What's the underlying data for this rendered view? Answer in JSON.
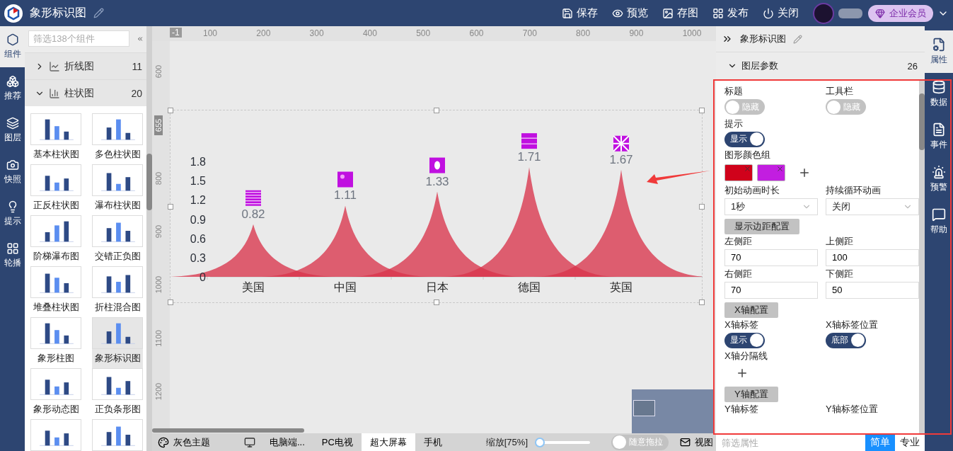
{
  "header": {
    "title": "象形标识图",
    "actions": [
      {
        "kind": "save",
        "label": "保存"
      },
      {
        "kind": "preview",
        "label": "预览"
      },
      {
        "kind": "image",
        "label": "存图"
      },
      {
        "kind": "publish",
        "label": "发布"
      },
      {
        "kind": "close",
        "label": "关闭"
      }
    ],
    "member": "企业会员"
  },
  "left_rail": [
    {
      "label": "组件",
      "selected": true
    },
    {
      "label": "推荐",
      "selected": false
    },
    {
      "label": "图层",
      "selected": false
    },
    {
      "label": "快照",
      "selected": false
    },
    {
      "label": "提示",
      "selected": false
    },
    {
      "label": "轮播",
      "selected": false
    }
  ],
  "components": {
    "search": {
      "placeholder": "筛选138个组件"
    },
    "categories": [
      {
        "label": "折线图",
        "count": "11",
        "expanded": false
      },
      {
        "label": "柱状图",
        "count": "20",
        "expanded": true
      }
    ],
    "items": [
      {
        "label": "基本柱状图",
        "selected": false
      },
      {
        "label": "多色柱状图",
        "selected": false
      },
      {
        "label": "正反柱状图",
        "selected": false
      },
      {
        "label": "瀑布柱状图",
        "selected": false
      },
      {
        "label": "阶梯瀑布图",
        "selected": false
      },
      {
        "label": "交错正负图",
        "selected": false
      },
      {
        "label": "堆叠柱状图",
        "selected": false
      },
      {
        "label": "折柱混合图",
        "selected": false
      },
      {
        "label": "象形柱图",
        "selected": false
      },
      {
        "label": "象形标识图",
        "selected": true
      },
      {
        "label": "象形动态图",
        "selected": false
      },
      {
        "label": "正负条形图",
        "selected": false
      }
    ]
  },
  "canvas": {
    "ruler_top": {
      "marker": "-1",
      "labels": [
        "100",
        "200",
        "300",
        "400",
        "500",
        "600",
        "700",
        "800",
        "900",
        "1000"
      ]
    },
    "ruler_left": {
      "marker": "655",
      "labels": [
        "600",
        "800",
        "900",
        "1000",
        "1100",
        "1200"
      ]
    },
    "chart": {
      "chart_data": {
        "type": "area",
        "categories": [
          "美国",
          "中国",
          "日本",
          "德国",
          "英国"
        ],
        "values": [
          0.82,
          1.11,
          1.33,
          1.71,
          1.67
        ],
        "ylim": [
          0,
          1.8
        ],
        "yticks": [
          0,
          0.3,
          0.6,
          0.9,
          1.2,
          1.5,
          1.8
        ],
        "data_labels": true
      }
    }
  },
  "properties": {
    "title": "象形标识图",
    "section": {
      "label": "图层参数",
      "count": "26",
      "expanded": true
    },
    "rows": [
      [
        {
          "kind": "toggle",
          "label": "标题",
          "on": false,
          "text": "隐藏"
        },
        {
          "kind": "toggle",
          "label": "工具栏",
          "on": false,
          "text": "隐藏"
        }
      ],
      [
        {
          "kind": "toggle",
          "label": "提示",
          "on": true,
          "text": "显示"
        }
      ],
      [
        {
          "kind": "colors",
          "label": "图形颜色组",
          "colors": [
            {
              "color": "#d0021b"
            },
            {
              "color": "#c21ee0"
            }
          ]
        }
      ],
      [
        {
          "kind": "select",
          "label": "初始动画时长",
          "value": "1秒"
        },
        {
          "kind": "select",
          "label": "持续循环动画",
          "value": "关闭"
        }
      ],
      [
        {
          "kind": "button",
          "label": "显示边距配置"
        }
      ],
      [
        {
          "kind": "input",
          "label": "左侧距",
          "value": "70"
        },
        {
          "kind": "input",
          "label": "上侧距",
          "value": "100"
        }
      ],
      [
        {
          "kind": "input",
          "label": "右侧距",
          "value": "70"
        },
        {
          "kind": "input",
          "label": "下侧距",
          "value": "50"
        }
      ],
      [
        {
          "kind": "button",
          "label": "X轴配置"
        }
      ],
      [
        {
          "kind": "toggle",
          "label": "X轴标签",
          "on": true,
          "text": "显示"
        },
        {
          "kind": "toggle",
          "label": "X轴标签位置",
          "on": true,
          "text": "底部"
        }
      ],
      [
        {
          "kind": "add",
          "label": "X轴分隔线"
        }
      ],
      [
        {
          "kind": "button",
          "label": "Y轴配置"
        }
      ],
      [
        {
          "kind": "label",
          "label": "Y轴标签"
        },
        {
          "kind": "label",
          "label": "Y轴标签位置"
        }
      ]
    ],
    "filter": {
      "placeholder": "筛选属性"
    },
    "modes": [
      {
        "label": "简单",
        "selected": true
      },
      {
        "label": "专业",
        "selected": false
      }
    ]
  },
  "right_rail": [
    {
      "label": "属性",
      "selected": true
    },
    {
      "label": "数据",
      "selected": false
    },
    {
      "label": "事件",
      "selected": false
    },
    {
      "label": "预警",
      "selected": false
    },
    {
      "label": "帮助",
      "selected": false
    }
  ],
  "bottom_bar": {
    "theme": "灰色主题",
    "devices": [
      {
        "label": "电脑端...",
        "selected": false
      },
      {
        "label": "PC电视",
        "selected": false
      },
      {
        "label": "超大屏幕",
        "selected": true
      },
      {
        "label": "手机",
        "selected": false
      }
    ],
    "zoom": {
      "label": "缩放[75%]",
      "level": 0.05
    },
    "drag": {
      "label": "随意拖拉",
      "on": false
    },
    "view": "视图"
  }
}
